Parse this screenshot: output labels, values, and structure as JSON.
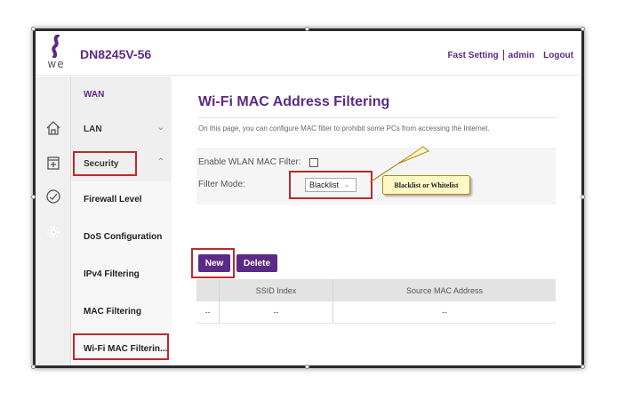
{
  "header": {
    "logo_text": "we",
    "model": "DN8245V-56",
    "links": [
      "Fast Setting",
      "admin",
      "Logout"
    ]
  },
  "sidebar": {
    "icons": [
      "home-icon",
      "security-plus-icon",
      "dashboard-gauge-icon",
      "gear-icon"
    ],
    "items": [
      {
        "label": "WAN"
      },
      {
        "label": "LAN",
        "chevron": "down"
      },
      {
        "label": "Security",
        "chevron": "up"
      }
    ],
    "subitems": [
      {
        "label": "Firewall Level"
      },
      {
        "label": "DoS Configuration"
      },
      {
        "label": "IPv4 Filtering"
      },
      {
        "label": "MAC Filtering"
      },
      {
        "label": "Wi-Fi MAC Filterin..."
      }
    ]
  },
  "main": {
    "title": "Wi-Fi MAC Address Filtering",
    "description": "On this page, you can configure MAC filter to prohibit some PCs from accessing the Internet.",
    "enable_label": "Enable WLAN MAC Filter:",
    "enable_checked": false,
    "filter_mode_label": "Filter Mode:",
    "filter_mode_value": "Blacklist",
    "callout": "Blacklist or Whitelist",
    "new_button": "New",
    "delete_button": "Delete",
    "table": {
      "columns": [
        "",
        "SSID Index",
        "Source MAC Address"
      ],
      "rows": [
        [
          "--",
          "--",
          "--"
        ]
      ]
    }
  },
  "colors": {
    "brand": "#5b2a86",
    "highlight": "#c0282d",
    "callout_bg": "#fff8c4"
  }
}
